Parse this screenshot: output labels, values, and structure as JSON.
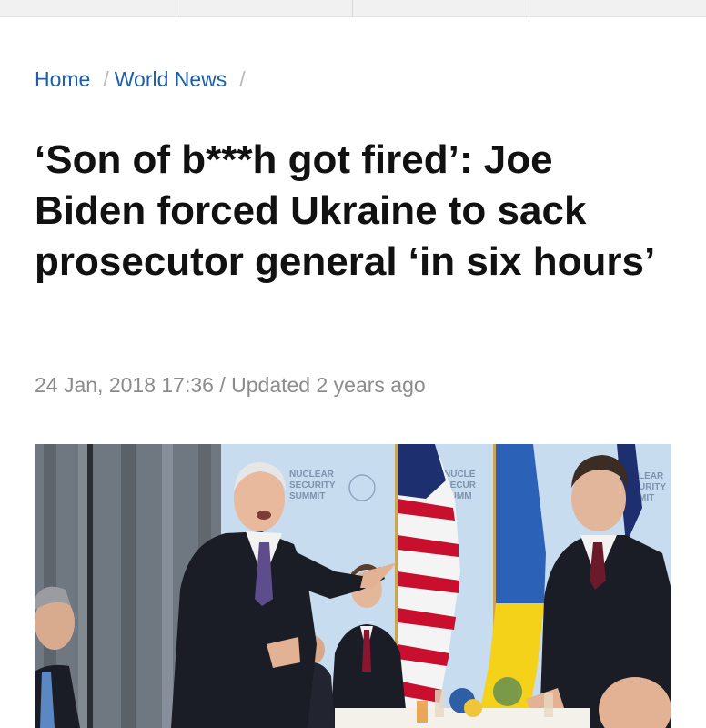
{
  "breadcrumb": {
    "home": "Home",
    "section": "World News",
    "separator": "/"
  },
  "article": {
    "headline": "‘Son of b***h got fired’: Joe Biden forced Ukraine to sack prosecutor general ‘in six hours’",
    "date": "24 Jan, 2018 17:36",
    "meta_separator": "/",
    "updated": "Updated 2 years ago"
  },
  "photo": {
    "backdrop_text_1": [
      "NUCLEAR",
      "SECURITY",
      "SUMMIT"
    ],
    "backdrop_text_2": [
      "NUCLE",
      "SECUR",
      "SUMM"
    ],
    "backdrop_text_3": [
      "LEAR",
      "URITY",
      "MIT"
    ],
    "colors": {
      "backdrop": "#b9d2ea",
      "curtain": "#6f7780",
      "flag_us_red": "#c8102e",
      "flag_us_blue": "#1d2f6f",
      "flag_ua_blue": "#2b62b8",
      "flag_ua_yellow": "#f4d21a",
      "suit": "#1b1d26"
    }
  }
}
